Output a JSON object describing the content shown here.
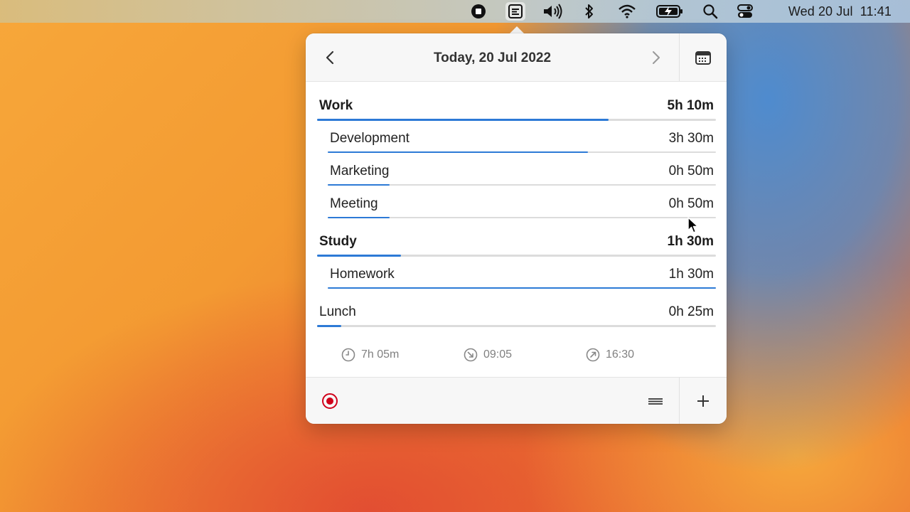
{
  "menubar": {
    "icons": [
      "stop-icon",
      "timesheet-app-icon",
      "volume-icon",
      "bluetooth-icon",
      "wifi-icon",
      "battery-charging-icon",
      "spotlight-search-icon",
      "control-center-icon"
    ],
    "clock": {
      "day": "Wed 20 Jul",
      "time": "11:41"
    }
  },
  "header": {
    "title": "Today, 20 Jul 2022"
  },
  "entries": [
    {
      "name": "Work",
      "duration": "5h 10m",
      "kind": "group",
      "progress": 0.73
    },
    {
      "name": "Development",
      "duration": "3h 30m",
      "kind": "child",
      "progress": 0.67
    },
    {
      "name": "Marketing",
      "duration": "0h 50m",
      "kind": "child",
      "progress": 0.16
    },
    {
      "name": "Meeting",
      "duration": "0h 50m",
      "kind": "child",
      "progress": 0.16
    },
    {
      "name": "Study",
      "duration": "1h 30m",
      "kind": "group",
      "progress": 0.21
    },
    {
      "name": "Homework",
      "duration": "1h 30m",
      "kind": "child",
      "progress": 1.0
    },
    {
      "name": "Lunch",
      "duration": "0h 25m",
      "kind": "group-plain",
      "progress": 0.06
    }
  ],
  "stats": {
    "total": "7h 05m",
    "start": "09:05",
    "end": "16:30"
  },
  "colors": {
    "accent": "#2d7ad6",
    "record": "#d0021b"
  }
}
